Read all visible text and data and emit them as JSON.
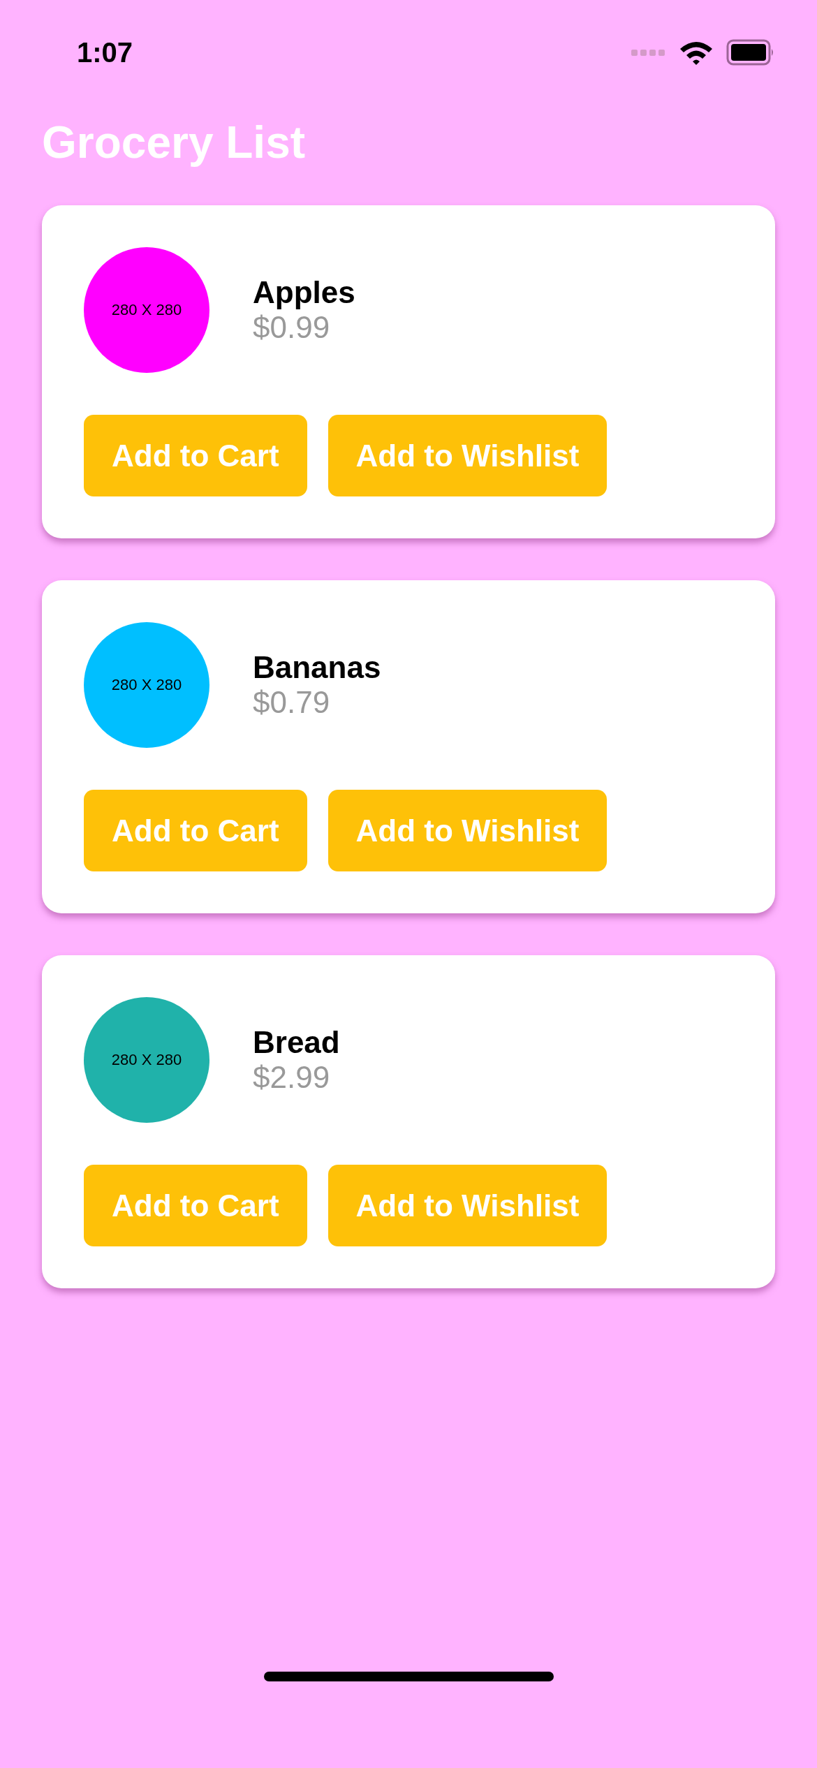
{
  "status_bar": {
    "time": "1:07"
  },
  "title": "Grocery List",
  "items": [
    {
      "name": "Apples",
      "price": "$0.99",
      "image_label": "280 X 280",
      "color": "#ff00ff",
      "buttons": [
        "Add to Cart",
        "Add to Wishlist"
      ]
    },
    {
      "name": "Bananas",
      "price": "$0.79",
      "image_label": "280 X 280",
      "color": "#00bfff",
      "buttons": [
        "Add to Cart",
        "Add to Wishlist"
      ]
    },
    {
      "name": "Bread",
      "price": "$2.99",
      "image_label": "280 X 280",
      "color": "#20b2aa",
      "buttons": [
        "Add to Cart",
        "Add to Wishlist"
      ]
    }
  ]
}
